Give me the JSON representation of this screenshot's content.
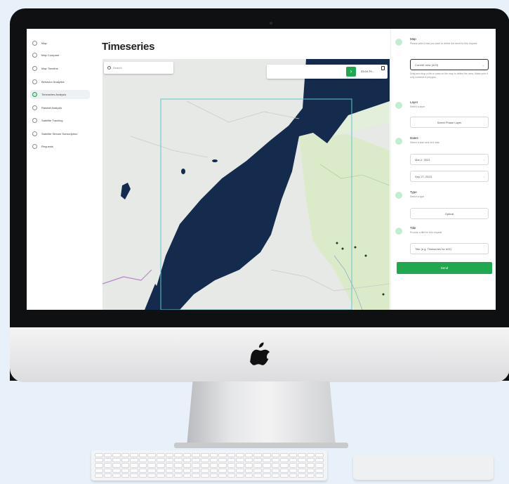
{
  "sidebar": {
    "items": [
      {
        "label": "Map",
        "icon": "globe-icon"
      },
      {
        "label": "Map Compare",
        "icon": "compare-icon"
      },
      {
        "label": "Map Timeline",
        "icon": "timeline-icon"
      },
      {
        "label": "Behavior Analytics",
        "icon": "analytics-icon"
      },
      {
        "label": "Timeseries Analysis",
        "icon": "timeseries-icon",
        "active": true
      },
      {
        "label": "Rainfall Analysis",
        "icon": "rain-icon"
      },
      {
        "label": "Satellite Tracking",
        "icon": "satellite-icon"
      },
      {
        "label": "Satellite Stream Subscription",
        "icon": "stream-icon"
      },
      {
        "label": "Requests",
        "icon": "requests-icon"
      }
    ]
  },
  "main": {
    "title": "Timeseries",
    "search_placeholder": "Search",
    "coords": "33.04.79..."
  },
  "panel": {
    "steps": [
      {
        "title": "Map",
        "subtitle": "Please select how you want to define the area for this request"
      },
      {
        "title": "Layer",
        "subtitle": "Select a layer"
      },
      {
        "title": "Dates",
        "subtitle": "Select a start and end date"
      },
      {
        "title": "Type",
        "subtitle": "Select a type"
      },
      {
        "title": "Title",
        "subtitle": "Provide a title for this request"
      }
    ],
    "area_select": "Current view (AOI)",
    "area_hint": "Drag and drop a file or draw on the map to define the area. Make sure it only contains a polygon.",
    "layer_button": "Select Phase Layer",
    "start_date": "Mar 2, 2023",
    "end_date": "Sep 27, 2023",
    "type_button": "Optical",
    "title_placeholder": "Title (e.g. Timeseries for AOI)",
    "submit_label": "Send"
  },
  "colors": {
    "accent": "#1fa84e",
    "water": "#142b4e",
    "land": "#e6e9e6",
    "vegetation": "#d9ebc6",
    "aoi_outline": "#5fc7cf"
  }
}
